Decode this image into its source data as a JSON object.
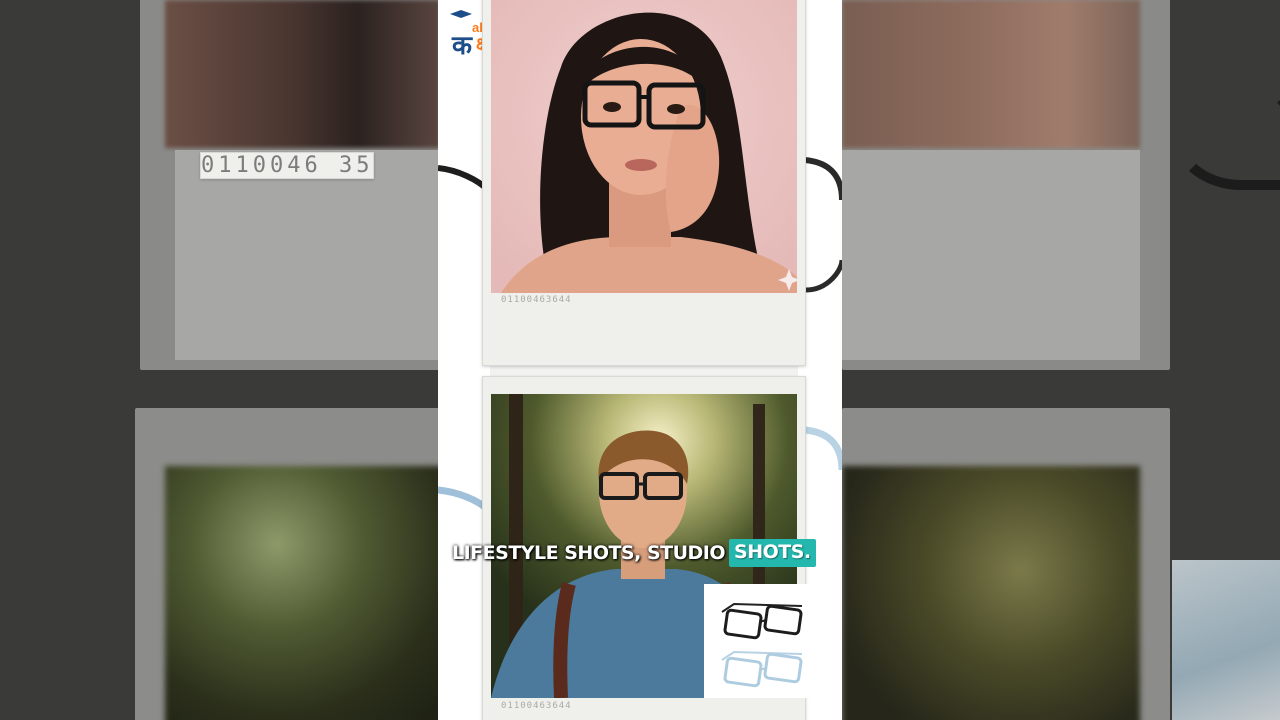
{
  "logo": {
    "text_top": "alent",
    "text_devanagari_1": "क",
    "text_devanagari_2": "क्षा"
  },
  "polaroids": {
    "top_serial": "01100463644",
    "bottom_serial": "01100463644",
    "side_serial": "0110046 35"
  },
  "caption": {
    "plain_text": "LIFESTYLE SHOTS, STUDIO",
    "highlighted_text": "SHOTS."
  },
  "colors": {
    "highlight": "#23b7ad",
    "logo_blue": "#1d4e8a",
    "logo_orange": "#ff7a1a",
    "portrait_bg": "#ecc7c5"
  },
  "icons": [
    "graduation-cap-icon",
    "sparkle-icon",
    "eyeglasses-black-icon",
    "eyeglasses-clear-icon"
  ]
}
